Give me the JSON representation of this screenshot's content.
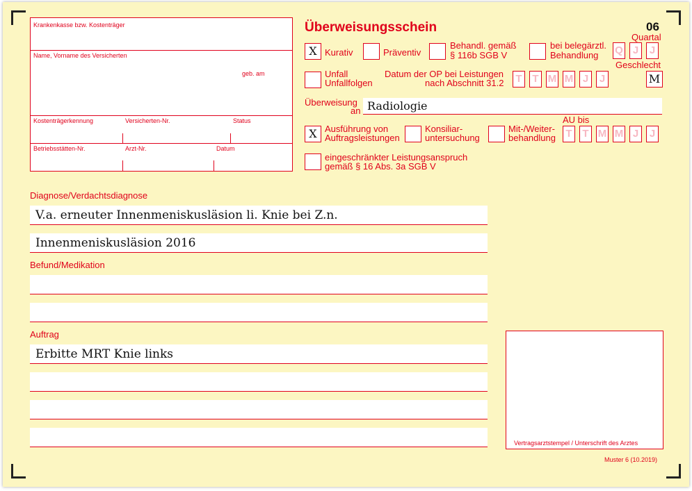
{
  "form": {
    "title": "Überweisungsschein",
    "number": "06",
    "footer": "Muster 6 (10.2019)"
  },
  "patient": {
    "krankenkasse_label": "Krankenkasse bzw. Kostenträger",
    "name_label": "Name, Vorname des Versicherten",
    "geb_label": "geb. am",
    "kostentraeger_label": "Kostenträgerkennung",
    "versicherten_label": "Versicherten-Nr.",
    "status_label": "Status",
    "betriebsstaetten_label": "Betriebsstätten-Nr.",
    "arzt_label": "Arzt-Nr.",
    "datum_label": "Datum"
  },
  "options": {
    "kurativ": {
      "label": "Kurativ",
      "mark": "X"
    },
    "praeventiv": {
      "label": "Präventiv",
      "mark": ""
    },
    "behandl_116b": {
      "label_line1": "Behandl. gemäß",
      "label_line2": "§ 116b SGB V",
      "mark": ""
    },
    "belegaerztl": {
      "label_line1": "bei belegärztl.",
      "label_line2": "Behandlung",
      "mark": ""
    },
    "unfall": {
      "label_line1": "Unfall",
      "label_line2": "Unfallfolgen",
      "mark": ""
    },
    "ausfuehrung": {
      "label_line1": "Ausführung von",
      "label_line2": "Auftragsleistungen",
      "mark": "X"
    },
    "konsiliar": {
      "label_line1": "Konsiliar-",
      "label_line2": "untersuchung",
      "mark": ""
    },
    "mitweiter": {
      "label_line1": "Mit-/Weiter-",
      "label_line2": "behandlung",
      "mark": ""
    },
    "eingeschraenkt": {
      "label_line1": "eingeschränkter Leistungsanspruch",
      "label_line2": "gemäß § 16 Abs. 3a SGB V",
      "mark": ""
    }
  },
  "quartal": {
    "label": "Quartal",
    "cells": [
      "Q",
      "J",
      "J"
    ]
  },
  "op_date": {
    "label_line1": "Datum der OP bei Leistungen",
    "label_line2": "nach Abschnitt 31.2",
    "cells": [
      "T",
      "T",
      "M",
      "M",
      "J",
      "J"
    ]
  },
  "geschlecht": {
    "label": "Geschlecht",
    "value": "M"
  },
  "ueberweisung": {
    "label_line1": "Überweisung",
    "label_line2": "an",
    "value": "Radiologie"
  },
  "au_bis": {
    "label": "AU bis",
    "cells": [
      "T",
      "T",
      "M",
      "M",
      "J",
      "J"
    ]
  },
  "diagnose": {
    "label": "Diagnose/Verdachtsdiagnose",
    "lines": [
      "V.a. erneuter Innenmeniskusläsion li. Knie bei Z.n.",
      "Innenmeniskusläsion 2016"
    ]
  },
  "befund": {
    "label": "Befund/Medikation",
    "lines": [
      "",
      ""
    ]
  },
  "auftrag": {
    "label": "Auftrag",
    "lines": [
      "Erbitte MRT Knie links",
      "",
      "",
      ""
    ]
  },
  "stempel": {
    "label": "Vertragsarztstempel / Unterschrift des Arztes"
  },
  "colors": {
    "accent": "#e0001b",
    "paper": "#fcf6c2",
    "cell_letter": "#f7b8c2"
  }
}
